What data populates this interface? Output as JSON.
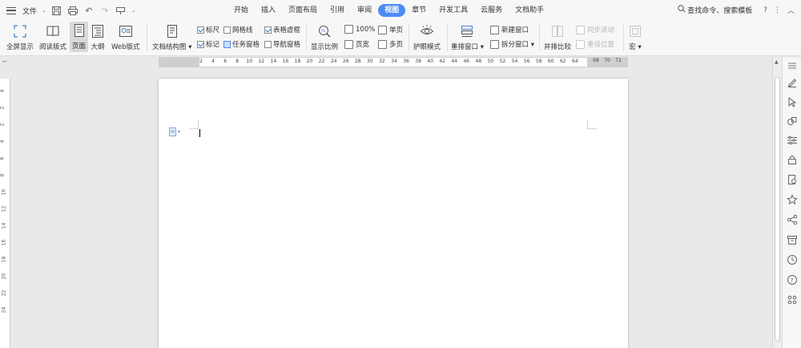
{
  "menubar": {
    "file_label": "文件",
    "tabs": [
      "开始",
      "插入",
      "页面布局",
      "引用",
      "审阅",
      "视图",
      "章节",
      "开发工具",
      "云服务",
      "文档助手"
    ],
    "active_tab": "视图",
    "search_label": "查找命令、搜索模板",
    "help_glyph": "?",
    "more_glyph": "⋮",
    "collapse_glyph": "︿"
  },
  "ribbon": {
    "fullscreen": "全屏显示",
    "reading": "阅读版式",
    "page": "页面",
    "outline": "大纲",
    "web": "Web版式",
    "doc_structure": "文档结构图",
    "ruler": "标尺",
    "gridlines": "网格线",
    "table_gridlines": "表格虚框",
    "markup": "标记",
    "task_pane": "任务窗格",
    "nav_pane": "导航窗格",
    "zoom": "显示比例",
    "zoom_100": "100%",
    "page_width": "页宽",
    "single_page": "单页",
    "multi_page": "多页",
    "eye_protect": "护眼模式",
    "rearrange": "重排窗口",
    "new_window": "新建窗口",
    "split_window": "拆分窗口",
    "side_by_side": "并排比较",
    "sync_scroll": "同步滚动",
    "reset_position": "重设位置",
    "macro": "宏"
  },
  "ruler": {
    "h_left_numbers": [
      "4",
      "2"
    ],
    "h_numbers": [
      "2",
      "4",
      "6",
      "8",
      "10",
      "12",
      "14",
      "16",
      "18",
      "20",
      "22",
      "24",
      "26",
      "28",
      "30",
      "32",
      "34",
      "36",
      "38",
      "40",
      "42",
      "44",
      "46",
      "48",
      "50",
      "52",
      "54",
      "56",
      "58",
      "60",
      "62",
      "64"
    ],
    "h_right_numbers": [
      "68",
      "70",
      "72"
    ],
    "v_numbers": [
      "4",
      "2",
      "2",
      "4",
      "6",
      "8",
      "10",
      "12",
      "14",
      "16",
      "18",
      "20",
      "22",
      "24"
    ]
  },
  "colors": {
    "accent": "#4b8bf4",
    "background": "#e9e9ea",
    "toolbar": "#f7f7f7"
  }
}
